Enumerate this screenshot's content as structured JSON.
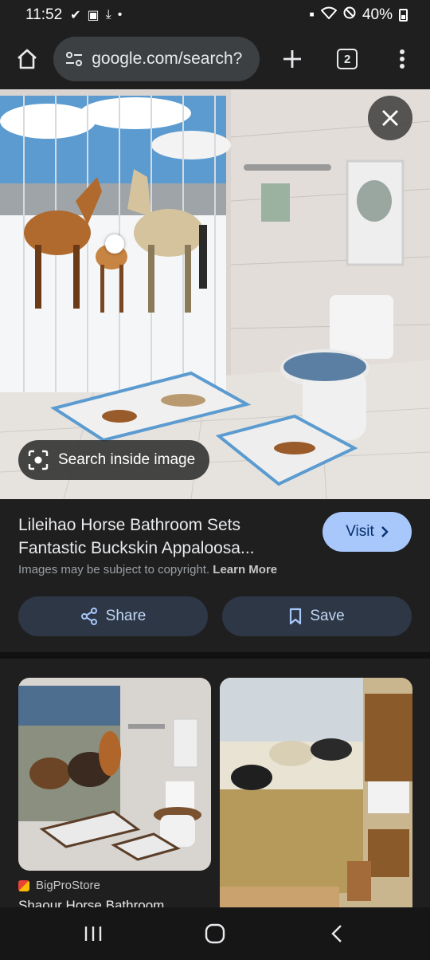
{
  "status": {
    "time": "11:52",
    "battery": "40%"
  },
  "browser": {
    "url": "google.com/search?",
    "tab_count": "2"
  },
  "hero": {
    "search_inside_label": "Search inside image"
  },
  "result": {
    "title": "Lileihao Horse Bathroom Sets Fantastic Buckskin Appaloosa...",
    "visit_label": "Visit",
    "copyright_text": "Images may be subject to copyright.",
    "learn_more_label": "Learn More",
    "share_label": "Share",
    "save_label": "Save"
  },
  "related": {
    "source_name": "BigProStore",
    "card_title": "Shaour Horse Bathroom"
  },
  "colors": {
    "visit_button": "#a8c7fa",
    "action_button": "#2d3746",
    "background": "#1f1f1f"
  }
}
